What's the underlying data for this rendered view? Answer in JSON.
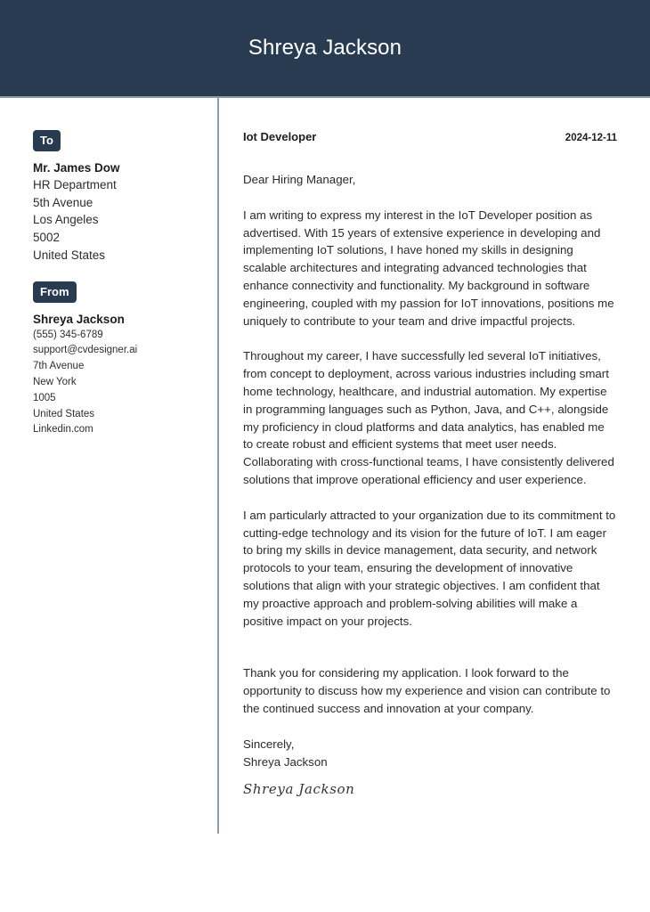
{
  "header": {
    "name": "Shreya Jackson"
  },
  "recipient": {
    "badge": "To",
    "name": "Mr. James Dow",
    "lines": [
      "HR Department",
      "5th Avenue",
      "Los Angeles",
      "5002",
      "United States"
    ]
  },
  "sender": {
    "badge": "From",
    "name": "Shreya Jackson",
    "lines": [
      "(555) 345-6789",
      "support@cvdesigner.ai",
      "7th Avenue",
      "New York",
      "1005",
      "United States",
      "Linkedin.com"
    ]
  },
  "letter": {
    "job_title": "Iot Developer",
    "date": "2024-12-11",
    "greeting": "Dear Hiring Manager,",
    "paragraphs": [
      "I am writing to express my interest in the IoT Developer position as advertised. With 15 years of extensive experience in developing and implementing IoT solutions, I have honed my skills in designing scalable architectures and integrating advanced technologies that enhance connectivity and functionality. My background in software engineering, coupled with my passion for IoT innovations, positions me uniquely to contribute to your team and drive impactful projects.",
      "Throughout my career, I have successfully led several IoT initiatives, from concept to deployment, across various industries including smart home technology, healthcare, and industrial automation. My expertise in programming languages such as Python, Java, and C++, alongside my proficiency in cloud platforms and data analytics, has enabled me to create robust and efficient systems that meet user needs. Collaborating with cross-functional teams, I have consistently delivered solutions that improve operational efficiency and user experience.",
      "I am particularly attracted to your organization due to its commitment to cutting-edge technology and its vision for the future of IoT. I am eager to bring my skills in device management, data security, and network protocols to your team, ensuring the development of innovative solutions that align with your strategic objectives. I am confident that my proactive approach and problem-solving abilities will make a positive impact on your projects.",
      "Thank you for considering my application. I look forward to the opportunity to discuss how my experience and vision can contribute to the continued success and innovation at your company."
    ],
    "closing": "Sincerely,",
    "closing_name": "Shreya Jackson",
    "signature": "Shreya Jackson"
  }
}
